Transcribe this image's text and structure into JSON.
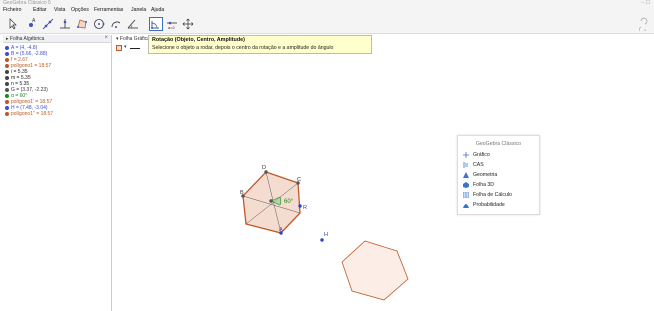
{
  "window": {
    "title": "GeoGebra Clássico 5",
    "controls": "– ☐"
  },
  "menu": [
    "Ficheiro",
    "Editar",
    "Vista",
    "Opções",
    "Ferramentas",
    "Janela",
    "Ajuda"
  ],
  "toolbar": {
    "tools": [
      {
        "name": "move-tool",
        "active": false
      },
      {
        "name": "point-tool",
        "active": false
      },
      {
        "name": "line-tool",
        "active": false
      },
      {
        "name": "perpendicular-tool",
        "active": false
      },
      {
        "name": "polygon-tool",
        "active": false
      },
      {
        "name": "circle-tool",
        "active": false
      },
      {
        "name": "arc-tool",
        "active": false
      },
      {
        "name": "angle-tool",
        "active": false
      },
      {
        "name": "rotate-tool",
        "active": true
      },
      {
        "name": "slider-tool",
        "active": false
      },
      {
        "name": "move-graphics-tool",
        "active": false
      }
    ]
  },
  "tooltip": {
    "title": "Rotação (Objeto, Centro, Amplitude)",
    "description": "Selecione o objeto a rodar, depois o centro da rotação e a amplitude do ângulo"
  },
  "algebra": {
    "title": "Folha Algébrica",
    "close": "×",
    "rows": [
      {
        "text": "A = (4, -4.8)",
        "color": "#3b4fd4",
        "text_color": "#3b4fd4"
      },
      {
        "text": "B = (5.66, -2.88)",
        "color": "#3b4fd4",
        "text_color": "#3b4fd4"
      },
      {
        "text": "f = 2.67",
        "color": "#c0561e",
        "text_color": "#c0561e"
      },
      {
        "text": "polígono1 = 18.57",
        "color": "#c0561e",
        "text_color": "#c0561e"
      },
      {
        "text": "i = 5.35",
        "color": "#444444",
        "text_color": "#222222"
      },
      {
        "text": "m = 5.35",
        "color": "#444444",
        "text_color": "#222222"
      },
      {
        "text": "n = 5.35",
        "color": "#444444",
        "text_color": "#222222"
      },
      {
        "text": "G = (3.37, -2.23)",
        "color": "#555555",
        "text_color": "#333333"
      },
      {
        "text": "α = 60°",
        "color": "#1a8a1a",
        "text_color": "#1a8a1a"
      },
      {
        "text": "polígono1' = 18.57",
        "color": "#c0561e",
        "text_color": "#c0561e"
      },
      {
        "text": "H = (7.48, -3.04)",
        "color": "#3b4fd4",
        "text_color": "#3b4fd4"
      },
      {
        "text": "polígono1'' = 18.57",
        "color": "#c0561e",
        "text_color": "#c0561e"
      }
    ]
  },
  "graphics": {
    "title": "Folha Gráfica 2",
    "close": "×",
    "point_labels": {
      "D": "D",
      "C": "C",
      "B": "B",
      "A": "A",
      "R": "R",
      "H": "H",
      "angle": "60°"
    }
  },
  "perspectives": {
    "title": "GeoGebra Clássico",
    "items": [
      {
        "label": "Gráfico",
        "icon": "graph-icon",
        "color": "#3b74c9"
      },
      {
        "label": "CAS",
        "icon": "cas-icon",
        "color": "#3b74c9"
      },
      {
        "label": "Geometria",
        "icon": "geometry-icon",
        "color": "#3b74c9"
      },
      {
        "label": "Folha 3D",
        "icon": "3d-icon",
        "color": "#3b74c9"
      },
      {
        "label": "Folha de Cálculo",
        "icon": "spreadsheet-icon",
        "color": "#3b74c9"
      },
      {
        "label": "Probabilidade",
        "icon": "probability-icon",
        "color": "#3b74c9"
      }
    ]
  },
  "colors": {
    "polygon_stroke": "#c05a2a",
    "polygon_fill": "#f3d6c8",
    "point_blue": "#2f3fd0",
    "angle_green": "#1a8a1a"
  }
}
